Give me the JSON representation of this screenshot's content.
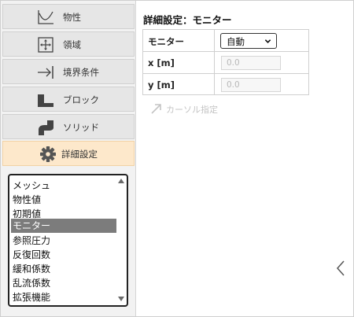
{
  "sidebar": {
    "items": [
      {
        "label": "物性",
        "icon": "curve-chart-icon"
      },
      {
        "label": "領域",
        "icon": "domain-move-icon"
      },
      {
        "label": "境界条件",
        "icon": "arrow-to-wall-icon"
      },
      {
        "label": "ブロック",
        "icon": "block-icon"
      },
      {
        "label": "ソリッド",
        "icon": "solid-shape-icon"
      },
      {
        "label": "詳細設定",
        "icon": "gear-icon",
        "active": true
      }
    ]
  },
  "list": {
    "items": [
      "メッシュ",
      "物性値",
      "初期値",
      "モニター",
      "参照圧力",
      "反復回数",
      "緩和係数",
      "乱流係数",
      "拡張機能"
    ],
    "selected": "モニター"
  },
  "panel": {
    "title": "詳細設定：モニター",
    "rows": {
      "monitor_label": "モニター",
      "monitor_value": "自動",
      "x_label": "x [m]",
      "x_placeholder": "0.0",
      "y_label": "y [m]",
      "y_placeholder": "0.0"
    },
    "cursor_button": "カーソル指定"
  },
  "colors": {
    "active_tab": "#fde8cb",
    "selected_item": "#7c7c7c",
    "disabled_text": "#c4c4c4"
  }
}
